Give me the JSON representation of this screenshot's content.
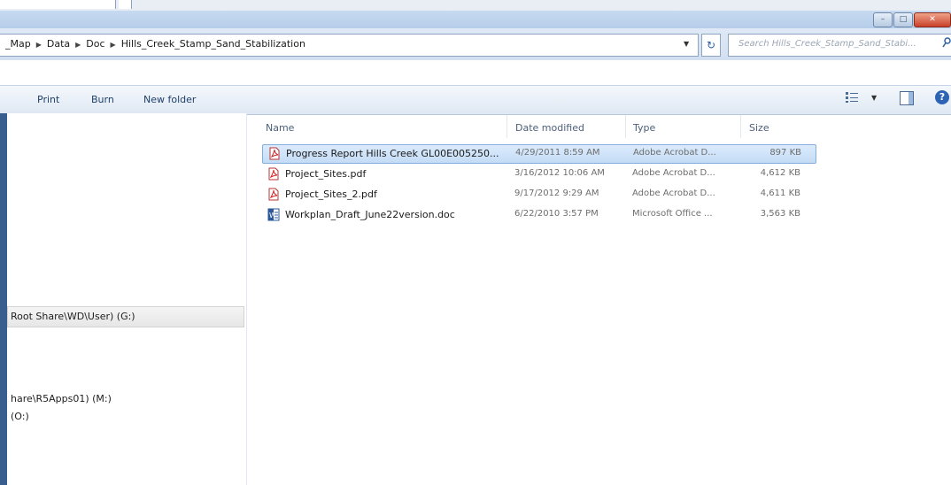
{
  "window": {
    "minimize_label": "–",
    "maximize_label": "□",
    "close_label": "✕"
  },
  "address": {
    "breadcrumb": [
      "_Map",
      "Data",
      "Doc",
      "Hills_Creek_Stamp_Sand_Stabilization"
    ],
    "search_placeholder": "Search Hills_Creek_Stamp_Sand_Stabi..."
  },
  "toolbar": {
    "print": "Print",
    "burn": "Burn",
    "new_folder": "New folder"
  },
  "nav": {
    "drive_g": "Root Share\\WD\\User) (G:)",
    "drive_m": "hare\\R5Apps01) (M:)",
    "drive_o": "(O:)"
  },
  "columns": {
    "name": "Name",
    "date": "Date modified",
    "type": "Type",
    "size": "Size"
  },
  "files": [
    {
      "name": "Progress Report Hills Creek GL00E005250...",
      "date": "4/29/2011 8:59 AM",
      "type": "Adobe Acrobat D...",
      "size": "897 KB",
      "icon": "pdf-icon"
    },
    {
      "name": "Project_Sites.pdf",
      "date": "3/16/2012 10:06 AM",
      "type": "Adobe Acrobat D...",
      "size": "4,612 KB",
      "icon": "pdf-icon"
    },
    {
      "name": "Project_Sites_2.pdf",
      "date": "9/17/2012 9:29 AM",
      "type": "Adobe Acrobat D...",
      "size": "4,611 KB",
      "icon": "pdf-icon"
    },
    {
      "name": "Workplan_Draft_June22version.doc",
      "date": "6/22/2010 3:57 PM",
      "type": "Microsoft Office ...",
      "size": "3,563 KB",
      "icon": "word-icon"
    }
  ],
  "colors": {
    "selection": "#c4dcf6",
    "accent": "#3a5d8f"
  }
}
